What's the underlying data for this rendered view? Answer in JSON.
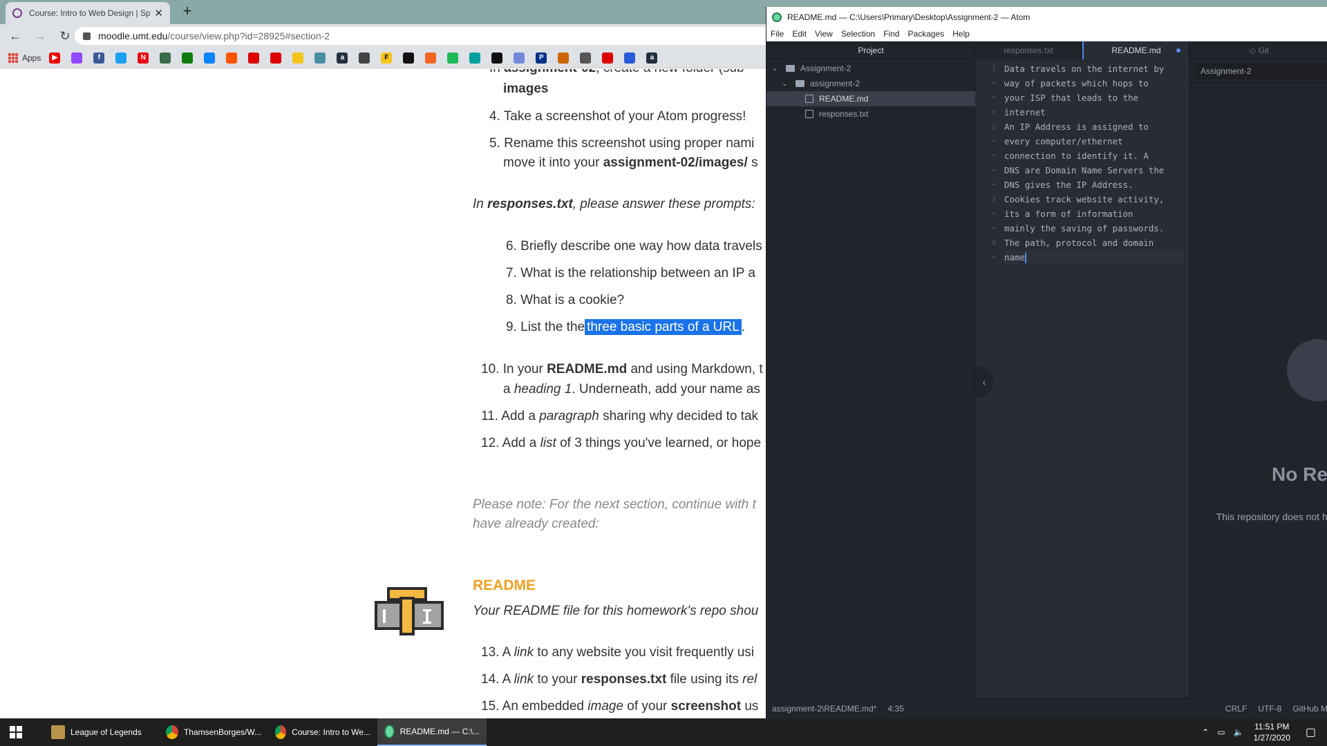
{
  "chrome": {
    "tab_title": "Course: Intro to Web Design | Sp",
    "url_domain": "moodle.umt.edu",
    "url_path": "/course/view.php?id=28925#section-2",
    "apps_label": "Apps"
  },
  "page": {
    "line_partial_top_a": "In",
    "line_partial_top_b": "assignment-02",
    "line_partial_top_c": ", create a new folder (sub",
    "line_images": "images",
    "item4": "Take a screenshot of your Atom progress!",
    "item5_a": "Rename this screenshot using proper nami",
    "item5_b": "move it into your",
    "item5_c": "assignment-02/images/",
    "item5_d": "s",
    "prompt_a": "In",
    "prompt_b": "responses.txt",
    "prompt_c": ", please answer these prompts:",
    "q6": "Briefly describe one way how data travels",
    "q7": "What is the relationship between an IP a",
    "q8": "What is a cookie?",
    "q9_a": "List the the",
    "q9_b": "three basic parts of a URL",
    "q9_c": ".",
    "i10_a": "In your",
    "i10_b": "README.md",
    "i10_c": "and using Markdown, t",
    "i10_d": "a",
    "i10_e": "heading 1",
    "i10_f": ". Underneath, add your name as",
    "i11_a": "Add a",
    "i11_b": "paragraph",
    "i11_c": "sharing why decided to tak",
    "i12_a": "Add a",
    "i12_b": "list",
    "i12_c": "of 3 things you've learned, or hope",
    "note_1": "Please note: For the next section, continue with t",
    "note_2": "have already created:",
    "readme_heading": "README",
    "readme_desc": "Your README file for this homework's repo shou",
    "i13_a": "A",
    "i13_b": "link",
    "i13_c": "to any website you visit frequently usi",
    "i14_a": "A",
    "i14_b": "link",
    "i14_c": "to your",
    "i14_d": "responses.txt",
    "i14_e": "file using its",
    "i14_f": "rel",
    "i15_a": "An embedded",
    "i15_b": "image",
    "i15_c": "of your",
    "i15_d": "screenshot",
    "i15_e": "us",
    "nums": [
      "4.",
      "5.",
      "6.",
      "7.",
      "8.",
      "9.",
      "10.",
      "11.",
      "12.",
      "13.",
      "14.",
      "15."
    ]
  },
  "atom": {
    "window_title": "README.md — C:\\Users\\Primary\\Desktop\\Assignment-2 — Atom",
    "menu": [
      "File",
      "Edit",
      "View",
      "Selection",
      "Find",
      "Packages",
      "Help"
    ],
    "tree_header": "Project",
    "tree": [
      "Assignment-2",
      "assignment-2",
      "README.md",
      "responses.txt"
    ],
    "tabs": [
      "responses.txt",
      "README.md"
    ],
    "git_tab": "Git",
    "git_branch": "Assignment-2",
    "code_lines": [
      "Data travels on the internet by",
      "way of packets which hops to",
      "your ISP that leads to the",
      "internet",
      "An IP Address is assigned to",
      "every computer/ethernet",
      "connection to identify it. A",
      "DNS are Domain Name Servers the",
      "DNS gives the IP Address.",
      "Cookies track website activity,",
      "its a form of information",
      "mainly the saving of passwords.",
      "The path, protocol and domain",
      "name"
    ],
    "gutter": [
      "1",
      "•",
      "•",
      "•",
      "2",
      "•",
      "•",
      "•",
      "•",
      "3",
      "•",
      "•",
      "4",
      "•"
    ],
    "no_repo_title": "No Re",
    "no_repo_desc": "This repository does not h at GitHu",
    "status_path": "assignment-2\\README.md*",
    "status_pos": "4:35",
    "status_eol": "CRLF",
    "status_enc": "UTF-8",
    "status_gh": "GitHub M"
  },
  "taskbar": {
    "items": [
      "League of Legends",
      "ThamsenBorges/W...",
      "Course: Intro to We...",
      "README.md — C:\\..."
    ],
    "time": "11:51 PM",
    "date": "1/27/2020"
  },
  "colors": {
    "selection": "#1a73e8",
    "readme_heading": "#f0a020",
    "atom_accent": "#568af2"
  }
}
